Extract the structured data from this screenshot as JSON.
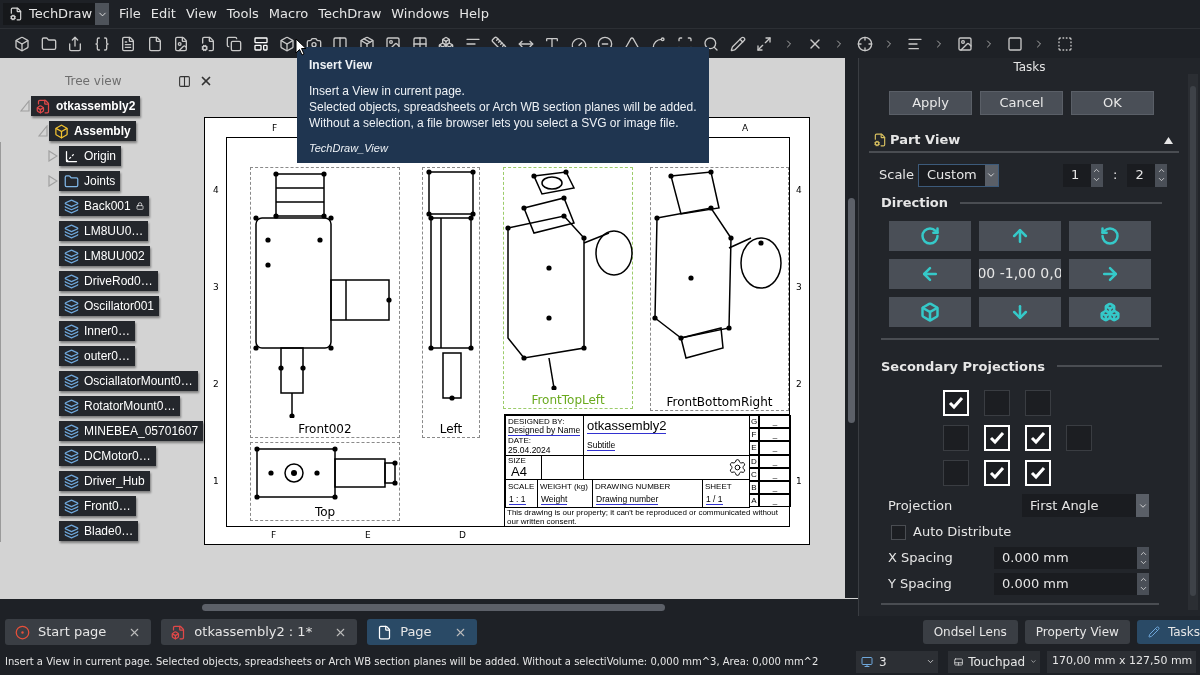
{
  "workbench": "TechDraw",
  "menus": [
    {
      "label": "File"
    },
    {
      "label": "Edit"
    },
    {
      "label": "View"
    },
    {
      "label": "Tools"
    },
    {
      "label": "Macro"
    },
    {
      "label": "TechDraw"
    },
    {
      "label": "Windows"
    },
    {
      "label": "Help"
    }
  ],
  "tooltip": {
    "title": "Insert View",
    "lines": [
      "Insert a View in current page.",
      "Selected objects, spreadsheets or Arch WB section planes will be added.",
      "Without a selection, a file browser lets you select a SVG or image file."
    ],
    "command": "TechDraw_View"
  },
  "tree_view": {
    "title": "Tree view",
    "items": [
      {
        "label": "otkassembly2",
        "kind": "document",
        "expanded": true,
        "children": [
          {
            "label": "Assembly",
            "kind": "assembly",
            "expanded": true,
            "children": [
              {
                "label": "Origin",
                "kind": "origin",
                "expanded": false,
                "locked": false
              },
              {
                "label": "Joints",
                "kind": "folder",
                "expanded": false,
                "locked": false
              },
              {
                "label": "Back001",
                "kind": "part",
                "locked": true
              },
              {
                "label": "LM8UU0…",
                "kind": "part",
                "locked": false
              },
              {
                "label": "LM8UU002",
                "kind": "part",
                "locked": false
              },
              {
                "label": "DriveRod0…",
                "kind": "part",
                "locked": false
              },
              {
                "label": "Oscillator001",
                "kind": "part",
                "locked": false
              },
              {
                "label": "Inner0…",
                "kind": "part",
                "locked": false
              },
              {
                "label": "outer0…",
                "kind": "part",
                "locked": false
              },
              {
                "label": "OsciallatorMount0…",
                "kind": "part",
                "locked": false
              },
              {
                "label": "RotatorMount0…",
                "kind": "part",
                "locked": false
              },
              {
                "label": "MINEBEA_05701607",
                "kind": "part",
                "locked": false
              },
              {
                "label": "DCMotor0…",
                "kind": "part",
                "locked": false
              },
              {
                "label": "Driver_Hub",
                "kind": "part",
                "locked": false
              },
              {
                "label": "Front0…",
                "kind": "part",
                "locked": false
              },
              {
                "label": "Blade0…",
                "kind": "part",
                "locked": false
              }
            ]
          }
        ]
      }
    ]
  },
  "sheet": {
    "top_labels": [
      "F",
      "A"
    ],
    "bottom_labels": [
      "F",
      "E",
      "D"
    ],
    "left_labels": [
      "4",
      "3",
      "2",
      "1"
    ],
    "right_labels": [
      "4",
      "3",
      "2",
      "1"
    ],
    "views": [
      {
        "label": "Front002",
        "selected": false
      },
      {
        "label": "Left",
        "selected": false
      },
      {
        "label": "FrontTopLeft",
        "selected": true
      },
      {
        "label": "FrontBottomRight",
        "selected": false
      },
      {
        "label": "Top",
        "selected": false
      }
    ],
    "title_block": {
      "designed_by_label": "DESIGNED BY:",
      "designed_by": "Designed by Name",
      "date_label": "DATE:",
      "date": "25.04.2024",
      "title": "otkassembly2",
      "subtitle": "Subtitle",
      "size_label": "SIZE",
      "size": "A4",
      "scale_label": "SCALE",
      "scale": "1 : 1",
      "weight_label": "WEIGHT (kg)",
      "weight": "Weight",
      "drawing_number_label": "DRAWING NUMBER",
      "drawing_number": "Drawing number",
      "sheet_label": "SHEET",
      "sheet": "1 / 1",
      "revisions": [
        {
          "letter": "G",
          "value": "_"
        },
        {
          "letter": "F",
          "value": "_"
        },
        {
          "letter": "E",
          "value": "_"
        },
        {
          "letter": "D",
          "value": "_"
        },
        {
          "letter": "C",
          "value": "_"
        },
        {
          "letter": "B",
          "value": "_"
        },
        {
          "letter": "A",
          "value": "_"
        }
      ],
      "disclaimer": "This drawing is our property; it can't be reproduced or communicated without our written consent."
    }
  },
  "tasks": {
    "title": "Tasks",
    "buttons": [
      "Apply",
      "Cancel",
      "OK"
    ],
    "section": {
      "title": "Part View",
      "expanded": true
    },
    "scale_label": "Scale",
    "scale_mode": "Custom",
    "scale_numerator": "1",
    "ratio_separator": ":",
    "scale_denominator": "2",
    "direction_title": "Direction",
    "direction_value": "00 -1,00 0,0",
    "secondary_title": "Secondary Projections",
    "projections": [
      {
        "cells": [
          {
            "checked": true
          },
          {
            "checked": false
          },
          {
            "checked": false
          }
        ]
      },
      {
        "cells": [
          {
            "checked": false
          },
          {
            "checked": true
          },
          {
            "checked": true
          },
          {
            "checked": false
          }
        ]
      },
      {
        "cells": [
          {
            "checked": false
          },
          {
            "checked": true
          },
          {
            "checked": true
          }
        ]
      }
    ],
    "projection_label": "Projection",
    "projection": "First Angle",
    "auto_distribute": {
      "label": "Auto Distribute",
      "checked": false
    },
    "spacings": [
      {
        "label": "X Spacing",
        "value": "0.000 mm"
      },
      {
        "label": "Y Spacing",
        "value": "0.000 mm"
      }
    ]
  },
  "doc_tabs": [
    {
      "label": "Start page",
      "kind": "start",
      "selected": false
    },
    {
      "label": "otkassembly2 : 1*",
      "kind": "document",
      "selected": false
    },
    {
      "label": "Page",
      "kind": "page",
      "selected": true
    }
  ],
  "panel_tabs": [
    {
      "label": "Ondsel Lens",
      "selected": false
    },
    {
      "label": "Property View",
      "selected": false
    },
    {
      "label": "Tasks",
      "selected": true
    }
  ],
  "status_bar": {
    "message": "Insert a View in current page. Selected objects, spreadsheets or Arch WB section planes will be added. Without a selecti",
    "measure": "Volume: 0,000 mm^3, Area: 0,000 mm^2",
    "combo": "3",
    "navigation": "Touchpad",
    "dimensions": "170,00 mm x 127,50 mm"
  }
}
